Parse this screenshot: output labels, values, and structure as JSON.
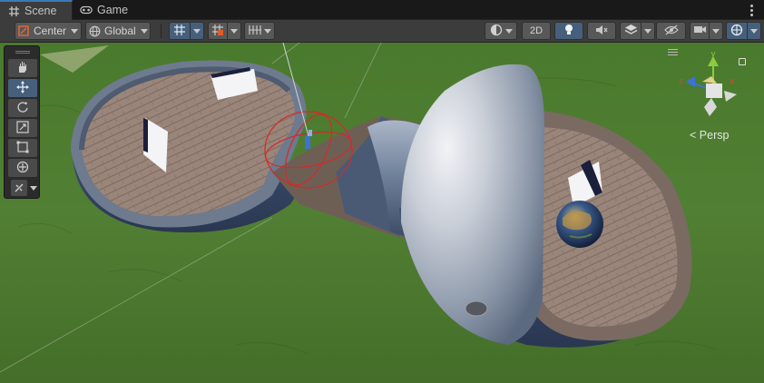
{
  "tabs": [
    {
      "label": "Scene",
      "icon": "hash-icon",
      "active": true
    },
    {
      "label": "Game",
      "icon": "gamepad-icon",
      "active": false
    }
  ],
  "toolbar": {
    "pivot_label": "Center",
    "space_label": "Global",
    "mode_2d": "2D"
  },
  "tools": [
    "hand-tool",
    "move-tool",
    "rotate-tool",
    "scale-tool",
    "rect-tool",
    "transform-tool",
    "custom-tool"
  ],
  "active_tool": "move-tool",
  "gizmo": {
    "axes": [
      "x",
      "y",
      "z"
    ],
    "persp_label": "Persp"
  },
  "colors": {
    "active_blue": "#46607c",
    "accent": "#3a79bb",
    "grass": "#4f7f31",
    "selection_red": "#d42a2a",
    "gizmo_x": "#d9423c",
    "gizmo_y": "#8ccc3c",
    "gizmo_z": "#3d72d4"
  }
}
